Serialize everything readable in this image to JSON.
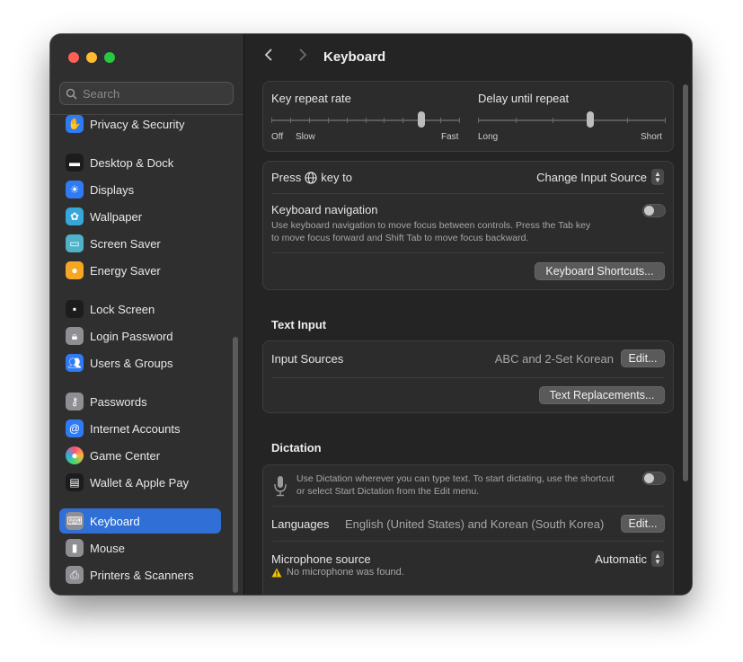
{
  "window": {
    "title": "Keyboard"
  },
  "search": {
    "placeholder": "Search"
  },
  "sidebar": {
    "items": [
      {
        "label": "Privacy & Security",
        "icon": "hand-icon",
        "color": "#2f7bf5"
      },
      {
        "label": "Desktop & Dock",
        "icon": "dock-icon",
        "color": "#1c1c1c"
      },
      {
        "label": "Displays",
        "icon": "sun-icon",
        "color": "#2f7bf5"
      },
      {
        "label": "Wallpaper",
        "icon": "flower-icon",
        "color": "#35a7d9"
      },
      {
        "label": "Screen Saver",
        "icon": "screensaver-icon",
        "color": "#4fb2c9"
      },
      {
        "label": "Energy Saver",
        "icon": "bulb-icon",
        "color": "#f5a623"
      },
      {
        "label": "Lock Screen",
        "icon": "lock-screen-icon",
        "color": "#1c1c1c"
      },
      {
        "label": "Login Password",
        "icon": "padlock-icon",
        "color": "#8e8e93"
      },
      {
        "label": "Users & Groups",
        "icon": "users-icon",
        "color": "#2f7bf5"
      },
      {
        "label": "Passwords",
        "icon": "key-icon",
        "color": "#8e8e93"
      },
      {
        "label": "Internet Accounts",
        "icon": "at-icon",
        "color": "#2f7bf5"
      },
      {
        "label": "Game Center",
        "icon": "game-center-icon",
        "color": "#e6e6e6"
      },
      {
        "label": "Wallet & Apple Pay",
        "icon": "wallet-icon",
        "color": "#1c1c1c"
      },
      {
        "label": "Keyboard",
        "icon": "keyboard-icon",
        "color": "#8e8e93",
        "selected": true
      },
      {
        "label": "Mouse",
        "icon": "mouse-icon",
        "color": "#8e8e93"
      },
      {
        "label": "Printers & Scanners",
        "icon": "printer-icon",
        "color": "#8e8e93"
      }
    ]
  },
  "keyrepeat": {
    "rate_label": "Key repeat rate",
    "rate_off": "Off",
    "rate_slow": "Slow",
    "rate_fast": "Fast",
    "rate_value": 0.8,
    "delay_label": "Delay until repeat",
    "delay_long": "Long",
    "delay_short": "Short",
    "delay_value": 0.6
  },
  "press_key": {
    "label_prefix": "Press",
    "label_suffix": "key to",
    "value": "Change Input Source"
  },
  "keyboard_nav": {
    "label": "Keyboard navigation",
    "desc1": "Use keyboard navigation to move focus between controls. Press the Tab key",
    "desc2": "to move focus forward and Shift Tab to move focus backward.",
    "enabled": false
  },
  "shortcuts_button": "Keyboard Shortcuts...",
  "text_input": {
    "section_title": "Text Input",
    "input_sources_label": "Input Sources",
    "input_sources_value": "ABC and 2-Set Korean",
    "edit_label": "Edit...",
    "text_replacements_button": "Text Replacements..."
  },
  "dictation": {
    "section_title": "Dictation",
    "desc1": "Use Dictation wherever you can type text. To start dictating, use the shortcut",
    "desc2": "or select Start Dictation from the Edit menu.",
    "enabled": false,
    "languages_label": "Languages",
    "languages_value": "English (United States) and Korean (South Korea)",
    "edit_label": "Edit...",
    "mic_label": "Microphone source",
    "mic_value": "Automatic",
    "mic_warning": "No microphone was found."
  }
}
